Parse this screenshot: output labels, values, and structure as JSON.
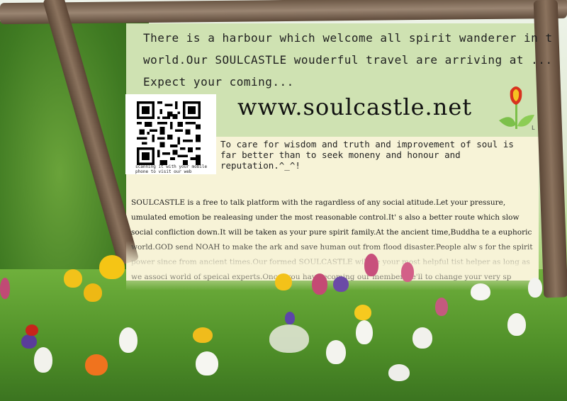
{
  "intro_lines": [
    "There is a harbour which welcome all spirit wanderer in t",
    "world.Our SOULCASTLE wouderful travel are arriving at ...",
    "Expect your coming..."
  ],
  "website": "www.soulcastle.net",
  "corner_mark": "L",
  "qr_caption": "scanning it with your mobile phone to visit our web",
  "motto": "To care for wisdom and truth and improvement of soul is far better than to seek moneny and honour and reputation.^_^!",
  "body_text": "SOULCASTLE is a free to talk platform with the ragardless of any social atitude.Let your pressure, umulated emotion be realeasing under the most reasonable control.It' s also a better route which slow social confliction down.It will be taken as your pure spirit family.At the ancient time,Buddha te a euphoric world.GOD send NOAH to make the ark and save human out from flood disaster.People alw s for the spirit power since from ancient times.Our formed SOULCASTLE will be your most helpful tist helper as long as we associ world of speical experts.Once ,you have ecoming our member,we'll to change your very sp",
  "colors": {
    "panel_green": "#cfe2b2",
    "panel_cream": "#f7f3d7",
    "branch": "#6a5644",
    "tulip_red": "#d8331f",
    "tulip_yellow": "#f6c321",
    "leaf_green": "#7cc04a"
  },
  "icons": [
    "qr-code-icon",
    "tulip-logo-icon"
  ]
}
